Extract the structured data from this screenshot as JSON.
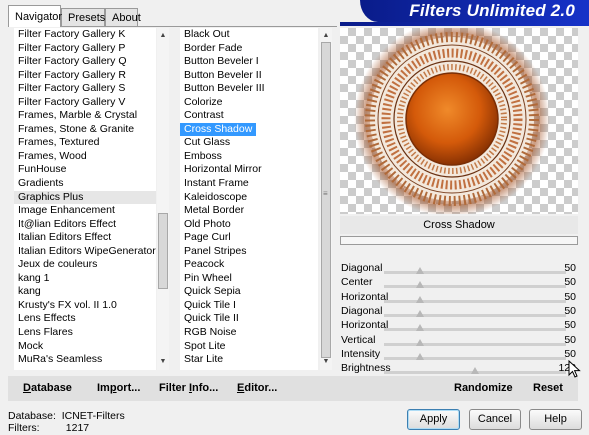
{
  "tabs": [
    {
      "label": "Navigator",
      "active": true
    },
    {
      "label": "Presets",
      "active": false
    },
    {
      "label": "About",
      "active": false
    }
  ],
  "app_title": "Filters Unlimited 2.0",
  "categories": {
    "items": [
      "Filter Factory Gallery K",
      "Filter Factory Gallery P",
      "Filter Factory Gallery Q",
      "Filter Factory Gallery R",
      "Filter Factory Gallery S",
      "Filter Factory Gallery V",
      "Frames, Marble & Crystal",
      "Frames, Stone & Granite",
      "Frames, Textured",
      "Frames, Wood",
      "FunHouse",
      "Gradients",
      "Graphics Plus",
      "Image Enhancement",
      "It@lian Editors Effect",
      "Italian Editors Effect",
      "Italian Editors WipeGenerator",
      "Jeux de couleurs",
      "kang 1",
      "kang",
      "Krusty's FX vol. II 1.0",
      "Lens Effects",
      "Lens Flares",
      "Mock",
      "MuRa's Seamless"
    ],
    "highlighted": "Graphics Plus"
  },
  "filters": {
    "items": [
      "Black Out",
      "Border Fade",
      "Button Beveler I",
      "Button Beveler II",
      "Button Beveler III",
      "Colorize",
      "Contrast",
      "Cross Shadow",
      "Cut Glass",
      "Emboss",
      "Horizontal Mirror",
      "Instant Frame",
      "Kaleidoscope",
      "Metal Border",
      "Old Photo",
      "Page Curl",
      "Panel Stripes",
      "Peacock",
      "Pin Wheel",
      "Quick Sepia",
      "Quick Tile I",
      "Quick Tile II",
      "RGB Noise",
      "Spot Lite",
      "Star Lite"
    ],
    "selected": "Cross Shadow"
  },
  "preview": {
    "filter_name": "Cross Shadow",
    "progress": 0
  },
  "params": [
    {
      "label": "Diagonal",
      "value": "50",
      "level": 0.196
    },
    {
      "label": "Center",
      "value": "50",
      "level": 0.196
    },
    {
      "label": "Horizontal",
      "value": "50",
      "level": 0.196
    },
    {
      "label": "Diagonal",
      "value": "50",
      "level": 0.196
    },
    {
      "label": "Horizontal",
      "value": "50",
      "level": 0.196
    },
    {
      "label": "Vertical",
      "value": "50",
      "level": 0.196
    },
    {
      "label": "Intensity",
      "value": "50",
      "level": 0.196
    },
    {
      "label": "Brightness",
      "value": "128",
      "level": 0.502
    }
  ],
  "toolbar": {
    "database": {
      "underlined": "D",
      "rest": "atabase"
    },
    "import": {
      "before": "Im",
      "underlined": "p",
      "rest": "ort..."
    },
    "filter_info": {
      "before": "Filter ",
      "underlined": "I",
      "rest": "nfo..."
    },
    "editor": {
      "underlined": "E",
      "rest": "ditor..."
    },
    "randomize": "Randomize",
    "reset": "Reset"
  },
  "status": {
    "database_label": "Database:",
    "database_value": "ICNET-Filters",
    "filters_label": "Filters:",
    "filters_value": "1217"
  },
  "buttons": {
    "apply": "Apply",
    "cancel": "Cancel",
    "help": "Help"
  },
  "colors": {
    "banner": "#0a1c8a",
    "selection": "#3399ff",
    "orb": "#d45a0a"
  }
}
